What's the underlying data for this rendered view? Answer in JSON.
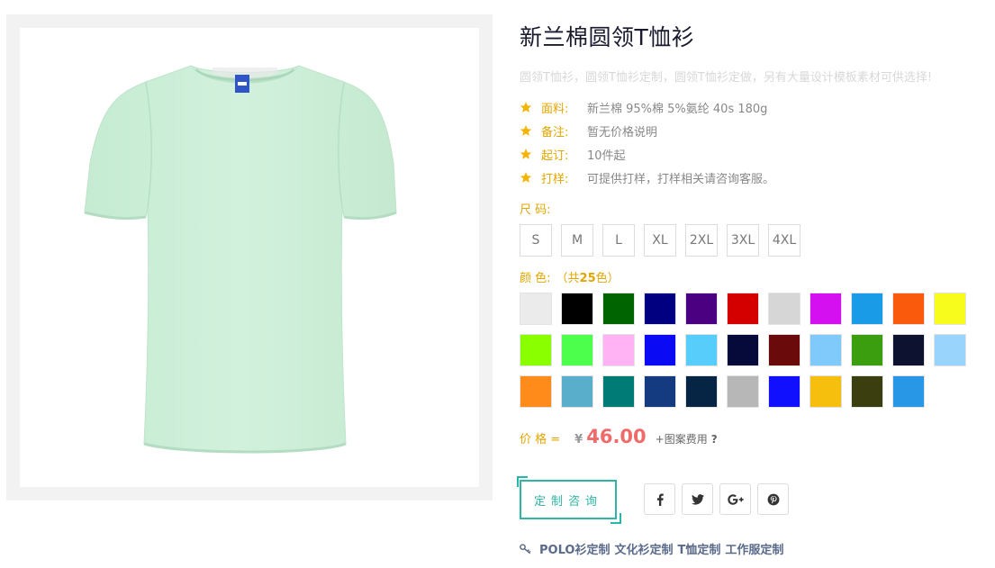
{
  "product": {
    "title": "新兰棉圆领T恤衫",
    "subtitle": "圆领T恤衫，圆领T恤衫定制，圆领T恤衫定做，另有大量设计模板素材可供选择!"
  },
  "attributes": [
    {
      "label": "面料:",
      "value": "新兰棉 95%棉 5%氨纶 40s 180g"
    },
    {
      "label": "备注:",
      "value": "暂无价格说明"
    },
    {
      "label": "起订:",
      "value": "10件起"
    },
    {
      "label": "打样:",
      "value": "可提供打样，打样相关请咨询客服。"
    }
  ],
  "size": {
    "label": "尺 码:",
    "options": [
      "S",
      "M",
      "L",
      "XL",
      "2XL",
      "3XL",
      "4XL"
    ]
  },
  "color": {
    "label": "颜 色:",
    "count_prefix": "（共",
    "count": "25",
    "count_suffix": "色）",
    "swatches": [
      "#ebebeb",
      "#000000",
      "#006400",
      "#000080",
      "#4b0082",
      "#d40000",
      "#d6d6d6",
      "#d40ff0",
      "#1a9be8",
      "#f95a0c",
      "#f7fc1c",
      "#8aff00",
      "#4cff4c",
      "#ffb3f5",
      "#0a0af5",
      "#57cdfb",
      "#050a3a",
      "#6a0a0a",
      "#7fcafa",
      "#3a9e0f",
      "#0c1230",
      "#98d4fc",
      "#ff8c1a",
      "#58aecb",
      "#007b76",
      "#143a80",
      "#062544",
      "#b7b7b7",
      "#1010ff",
      "#f6bf0e",
      "#3b3e0e",
      "#2898e6"
    ]
  },
  "price": {
    "label": "价 格 =",
    "currency": "¥",
    "value": "46.00",
    "extra": "+图案费用",
    "help": "?"
  },
  "consult_button": "定制咨询",
  "social": [
    {
      "icon": "facebook-icon",
      "glyph": "f"
    },
    {
      "icon": "twitter-icon",
      "glyph": "twitter"
    },
    {
      "icon": "google-plus-icon",
      "glyph": "G+"
    },
    {
      "icon": "pinterest-icon",
      "glyph": "p"
    }
  ],
  "tags": [
    "POLO衫定制",
    "文化衫定制",
    "T恤定制",
    "工作服定制"
  ],
  "colors": {
    "accent": "#e2a600",
    "teal": "#2fb5a6",
    "price": "#f06a6a",
    "shirt": "#cdeedb"
  }
}
